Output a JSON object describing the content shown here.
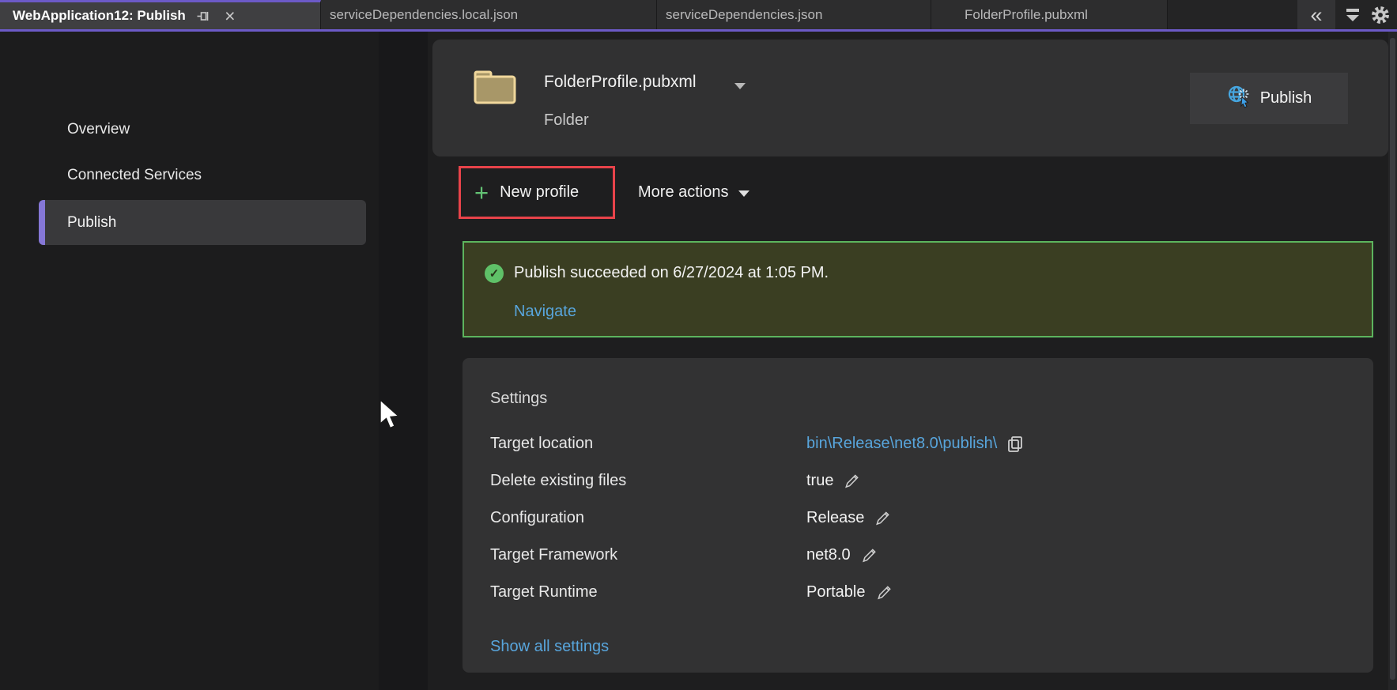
{
  "tab_bar": {
    "active_tab_label": "WebApplication12: Publish",
    "tabs": [
      "serviceDependencies.local.json",
      "serviceDependencies.json",
      "FolderProfile.pubxml"
    ],
    "icons": [
      "double-chevron-left",
      "open-tab-list",
      "settings-gear"
    ]
  },
  "sidebar": {
    "items": [
      {
        "label": "Overview",
        "selected": false
      },
      {
        "label": "Connected Services",
        "selected": false
      },
      {
        "label": "Publish",
        "selected": true
      }
    ]
  },
  "header": {
    "profile_name": "FolderProfile.pubxml",
    "profile_type": "Folder",
    "publish_label": "Publish"
  },
  "actions": {
    "new_profile_label": "New profile",
    "more_actions_label": "More actions"
  },
  "banner": {
    "message": "Publish succeeded on 6/27/2024 at 1:05 PM.",
    "link_label": "Navigate"
  },
  "settings": {
    "title": "Settings",
    "rows": [
      {
        "label": "Target location",
        "value": "bin\\Release\\net8.0\\publish\\",
        "value_kind": "link-with-copy"
      },
      {
        "label": "Delete existing files",
        "value": "true",
        "value_kind": "editable"
      },
      {
        "label": "Configuration",
        "value": "Release",
        "value_kind": "editable"
      },
      {
        "label": "Target Framework",
        "value": "net8.0",
        "value_kind": "editable"
      },
      {
        "label": "Target Runtime",
        "value": "Portable",
        "value_kind": "editable"
      }
    ],
    "footer_link": "Show all settings"
  },
  "colors": {
    "accent_purple": "#6c5ac7",
    "success_green": "#5cb45e",
    "banner_olive": "#3a3e22",
    "highlight_red": "#e8434a",
    "link_blue": "#58a5dc",
    "plus_green": "#63c274",
    "folder_tan": "#f0d79b",
    "card_gray": "#323233"
  }
}
